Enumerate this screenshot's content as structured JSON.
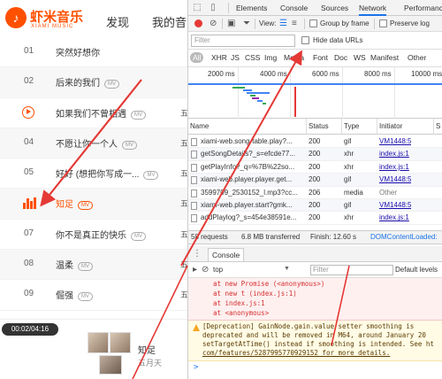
{
  "app": {
    "logo_mark": "♪",
    "logo_text": "虾米音乐",
    "logo_sub": "XIAMI MUSIC",
    "nav": {
      "discover": "发现",
      "mine": "我的音"
    },
    "songs": [
      {
        "num": "01",
        "title": "突然好想你",
        "mv": false,
        "tail": ""
      },
      {
        "num": "02",
        "title": "后来的我们",
        "mv": true,
        "tail": ""
      },
      {
        "num": "",
        "title": "如果我们不曾相遇",
        "mv": true,
        "tail": "五"
      },
      {
        "num": "04",
        "title": "不愿让你一个人",
        "mv": true,
        "tail": "五"
      },
      {
        "num": "05",
        "title": "好好 (想把你写成一...",
        "mv": true,
        "tail": "五"
      },
      {
        "num": "",
        "title": "知足",
        "mv": true,
        "tail": "五"
      },
      {
        "num": "07",
        "title": "你不是真正的快乐",
        "mv": true,
        "tail": "五"
      },
      {
        "num": "08",
        "title": "温柔",
        "mv": true,
        "tail": "五"
      },
      {
        "num": "09",
        "title": "倔强",
        "mv": true,
        "tail": "五"
      }
    ],
    "mv_label": "MV",
    "player": {
      "time": "00:02/04:16",
      "title": "知足",
      "artist": "五月天"
    }
  },
  "devtools": {
    "tabs": [
      "Elements",
      "Console",
      "Sources",
      "Network",
      "Performance"
    ],
    "active_tab": "Network",
    "toolbar": {
      "view_label": "View:",
      "group_by_frame": "Group by frame",
      "preserve_log": "Preserve log"
    },
    "filter_placeholder": "Filter",
    "hide_data_urls": "Hide data URLs",
    "types": [
      "All",
      "XHR",
      "JS",
      "CSS",
      "Img",
      "Media",
      "Font",
      "Doc",
      "WS",
      "Manifest",
      "Other"
    ],
    "active_type": "All",
    "timeline_labels": [
      "2000 ms",
      "4000 ms",
      "6000 ms",
      "8000 ms",
      "10000 ms"
    ],
    "columns": [
      "Name",
      "Status",
      "Type",
      "Initiator",
      "S"
    ],
    "rows": [
      {
        "name": "xiami-web.song-table.play?...",
        "status": "200",
        "type": "gif",
        "initiator": "VM1448:5",
        "link": true
      },
      {
        "name": "getSongDetails?_s=efcde77...",
        "status": "200",
        "type": "xhr",
        "initiator": "index.js:1",
        "link": true
      },
      {
        "name": "getPlayInfo?_q=%7B%22so...",
        "status": "200",
        "type": "xhr",
        "initiator": "index.js:1",
        "link": true
      },
      {
        "name": "xiami-web.player.player.get...",
        "status": "200",
        "type": "gif",
        "initiator": "VM1448:5",
        "link": true
      },
      {
        "name": "3599709_2530152_l.mp3?cc...",
        "status": "206",
        "type": "media",
        "initiator": "Other",
        "link": false
      },
      {
        "name": "xiami-web.player.start?gmk...",
        "status": "200",
        "type": "gif",
        "initiator": "VM1448:5",
        "link": true
      },
      {
        "name": "addPlaylog?_s=454e38591e...",
        "status": "200",
        "type": "xhr",
        "initiator": "index.js:1",
        "link": true
      }
    ],
    "summary": {
      "requests": "58 requests",
      "transferred": "6.8 MB transferred",
      "finish": "Finish: 12.60 s",
      "dcl": "DOMContentLoaded:"
    },
    "drawer_tab": "Console",
    "console": {
      "context": "top",
      "filter_placeholder": "Filter",
      "levels": "Default levels",
      "error_lines": [
        "at new Promise (<anonymous>)",
        "at new t (index.js:1)",
        "at index.js:1",
        "at <anonymous>"
      ],
      "warning_lines": [
        "[Deprecation] GainNode.gain.value setter smoothing is",
        "deprecated and will be removed in M64, around January 20",
        "setTargetAtTime() instead if smoothing is intended. See ht",
        "com/features/5287995770929152 for more details."
      ],
      "prompt": ">"
    }
  },
  "colors": {
    "brand": "#ff5000",
    "accent": "#1a73e8",
    "annotation": "#e53935"
  },
  "icons": [
    "inspect-icon",
    "device-icon",
    "record-icon",
    "clear-icon",
    "camera-icon",
    "filter-icon",
    "list-view-icon",
    "waterfall-view-icon",
    "console-menu-icon",
    "warning-icon"
  ]
}
